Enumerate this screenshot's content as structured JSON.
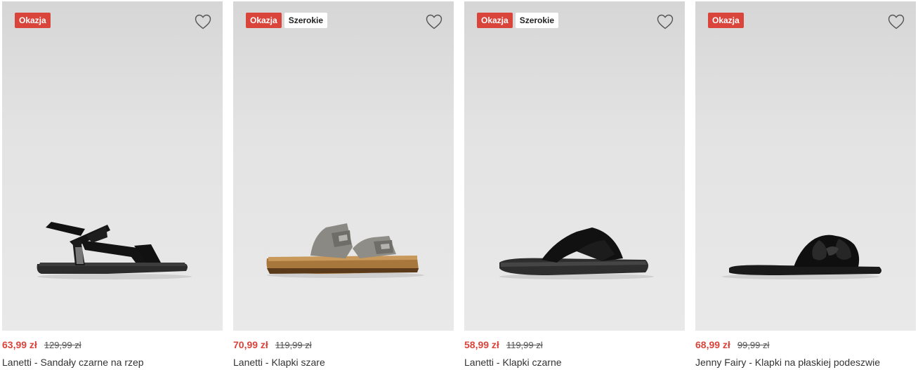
{
  "colors": {
    "sale": "#d9443b",
    "text": "#333333",
    "image_bg": "#e3e3e3"
  },
  "currency": "zł",
  "products": [
    {
      "badges": [
        "Okazja"
      ],
      "price": "63,99 zł",
      "old_price": "129,99 zł",
      "title": "Lanetti - Sandały czarne na rzep",
      "wishlist_icon": "heart-outline-icon"
    },
    {
      "badges": [
        "Okazja",
        "Szerokie"
      ],
      "price": "70,99 zł",
      "old_price": "119,99 zł",
      "title": "Lanetti - Klapki szare",
      "wishlist_icon": "heart-outline-icon"
    },
    {
      "badges": [
        "Okazja",
        "Szerokie"
      ],
      "price": "58,99 zł",
      "old_price": "119,99 zł",
      "title": "Lanetti - Klapki czarne",
      "wishlist_icon": "heart-outline-icon"
    },
    {
      "badges": [
        "Okazja"
      ],
      "price": "68,99 zł",
      "old_price": "99,99 zł",
      "title": "Jenny Fairy - Klapki na płaskiej podeszwie",
      "wishlist_icon": "heart-outline-icon"
    }
  ]
}
